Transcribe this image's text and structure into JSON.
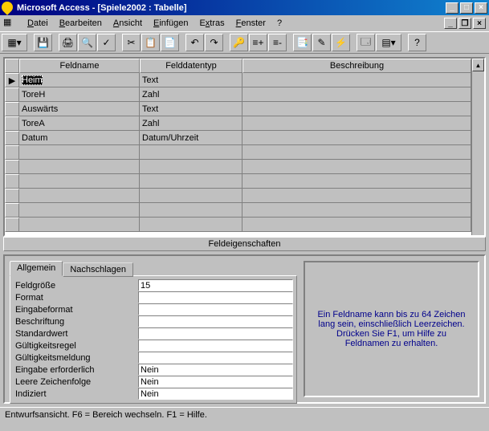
{
  "title": "Microsoft Access - [Spiele2002 : Tabelle]",
  "menu": {
    "datei": "Datei",
    "bearbeiten": "Bearbeiten",
    "ansicht": "Ansicht",
    "einfuegen": "Einfügen",
    "extras": "Extras",
    "fenster": "Fenster",
    "hilfe": "?"
  },
  "headers": {
    "feldname": "Feldname",
    "felddatentyp": "Felddatentyp",
    "beschreibung": "Beschreibung"
  },
  "rows": [
    {
      "name": "Heim",
      "type": "Text",
      "desc": "",
      "sel": true
    },
    {
      "name": "ToreH",
      "type": "Zahl",
      "desc": ""
    },
    {
      "name": "Auswärts",
      "type": "Text",
      "desc": ""
    },
    {
      "name": "ToreA",
      "type": "Zahl",
      "desc": ""
    },
    {
      "name": "Datum",
      "type": "Datum/Uhrzeit",
      "desc": ""
    }
  ],
  "field_props_title": "Feldeigenschaften",
  "tabs": {
    "allgemein": "Allgemein",
    "nachschlagen": "Nachschlagen"
  },
  "props": [
    {
      "label": "Feldgröße",
      "value": "15"
    },
    {
      "label": "Format",
      "value": ""
    },
    {
      "label": "Eingabeformat",
      "value": ""
    },
    {
      "label": "Beschriftung",
      "value": ""
    },
    {
      "label": "Standardwert",
      "value": ""
    },
    {
      "label": "Gültigkeitsregel",
      "value": ""
    },
    {
      "label": "Gültigkeitsmeldung",
      "value": ""
    },
    {
      "label": "Eingabe erforderlich",
      "value": "Nein"
    },
    {
      "label": "Leere Zeichenfolge",
      "value": "Nein"
    },
    {
      "label": "Indiziert",
      "value": "Nein"
    }
  ],
  "help_text": "Ein Feldname kann bis zu 64 Zeichen lang sein, einschließlich Leerzeichen. Drücken Sie F1, um Hilfe zu Feldnamen zu erhalten.",
  "status": "Entwurfsansicht. F6 = Bereich wechseln. F1 = Hilfe."
}
